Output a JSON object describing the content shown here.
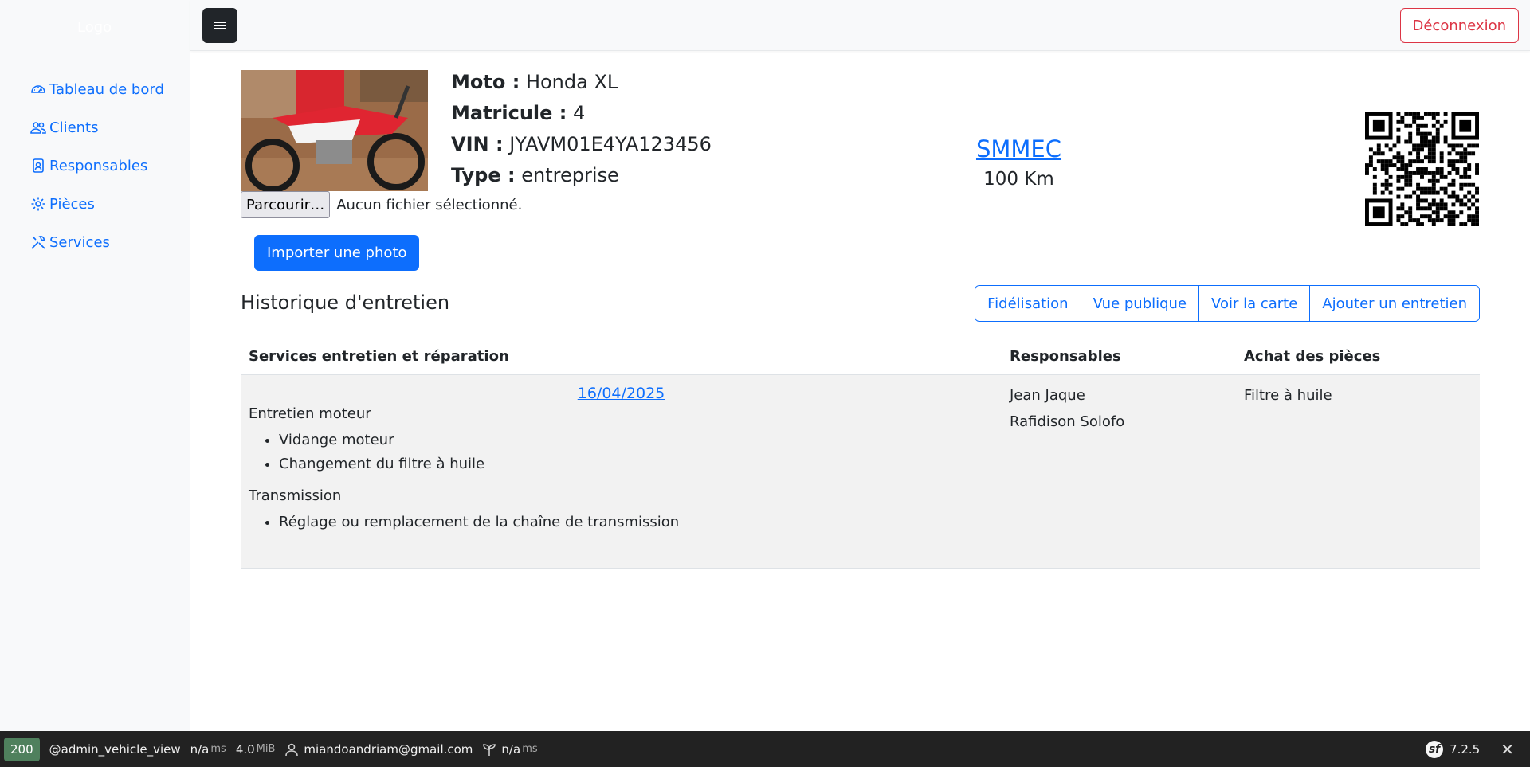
{
  "sidebar": {
    "logo": "Logo",
    "items": [
      {
        "label": "Tableau de bord",
        "icon": "speedometer-icon"
      },
      {
        "label": "Clients",
        "icon": "people-icon"
      },
      {
        "label": "Responsables",
        "icon": "badge-icon"
      },
      {
        "label": "Pièces",
        "icon": "gear-icon"
      },
      {
        "label": "Services",
        "icon": "tools-icon"
      }
    ]
  },
  "topbar": {
    "logout_label": "Déconnexion"
  },
  "vehicle": {
    "moto_label": "Moto :",
    "moto_value": "Honda XL",
    "matricule_label": "Matricule :",
    "matricule_value": "4",
    "vin_label": "VIN :",
    "vin_value": "JYAVM01E4YA123456",
    "type_label": "Type :",
    "type_value": "entreprise",
    "company": "SMMEC",
    "mileage": "100 Km"
  },
  "upload": {
    "browse_label": "Parcourir…",
    "file_status": "Aucun fichier sélectionné.",
    "import_label": "Importer une photo"
  },
  "history": {
    "title": "Historique d'entretien",
    "actions": [
      "Fidélisation",
      "Vue publique",
      "Voir la carte",
      "Ajouter un entretien"
    ],
    "columns": [
      "Services entretien et réparation",
      "Responsables",
      "Achat des pièces"
    ],
    "rows": [
      {
        "date": "16/04/2025",
        "groups": [
          {
            "title": "Entretien moteur",
            "items": [
              "Vidange moteur",
              "Changement du filtre à huile"
            ]
          },
          {
            "title": "Transmission",
            "items": [
              "Réglage ou remplacement de la chaîne de transmission"
            ]
          }
        ],
        "responsables": [
          "Jean Jaque",
          "Rafidison Solofo"
        ],
        "pieces": [
          "Filtre à huile"
        ]
      }
    ]
  },
  "debug": {
    "status": "200",
    "route": "@admin_vehicle_view",
    "time_value": "n/a",
    "time_unit": "ms",
    "memory_value": "4.0",
    "memory_unit": "MiB",
    "user": "miandoandriam@gmail.com",
    "init_value": "n/a",
    "init_unit": "ms",
    "version": "7.2.5"
  },
  "colors": {
    "primary": "#0d6efd",
    "danger": "#dc3545",
    "dark": "#212529",
    "status_green": "#4f805d"
  }
}
